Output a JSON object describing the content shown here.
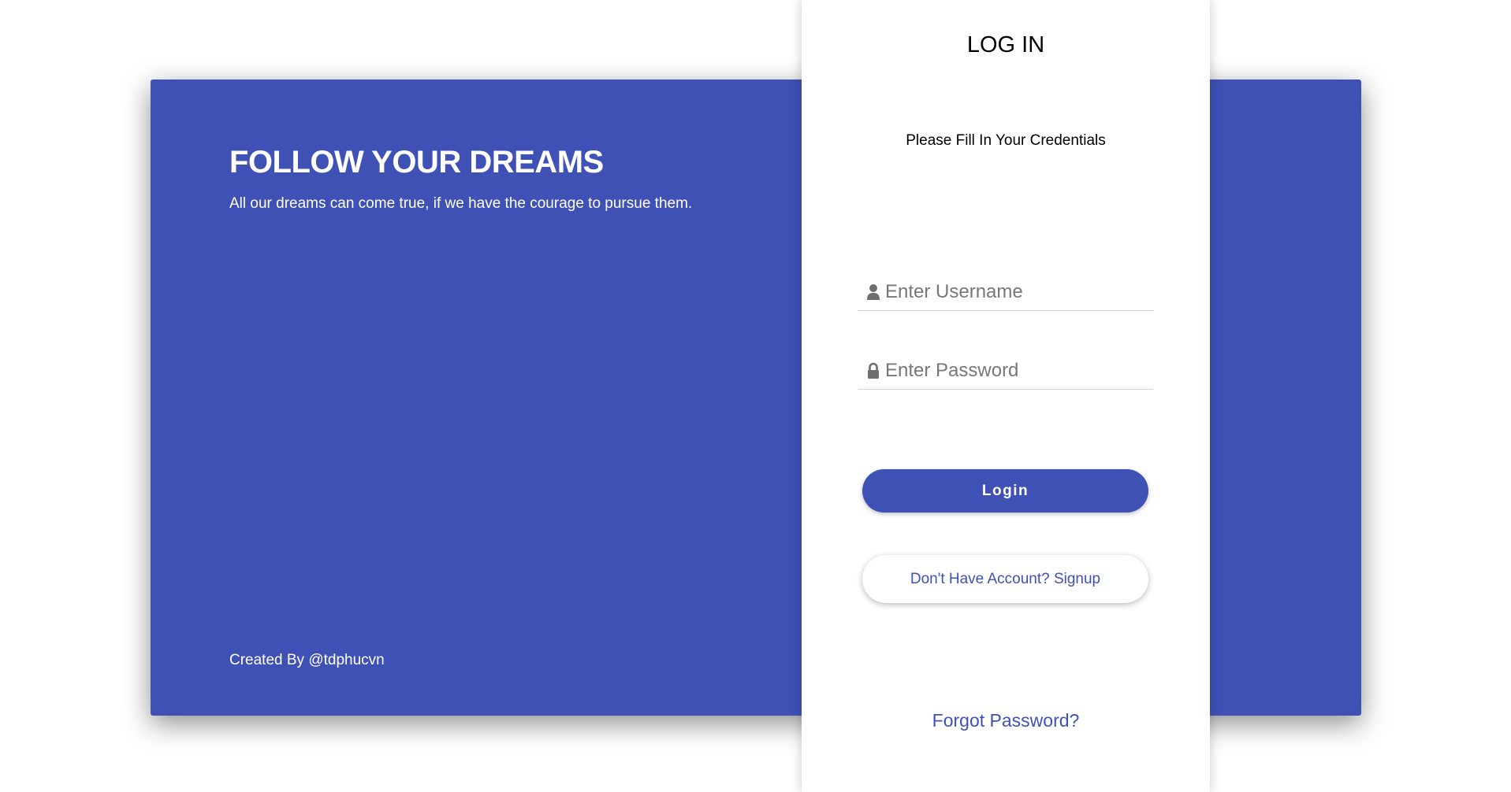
{
  "colors": {
    "accent": "#3f51b5",
    "background": "#ffffff",
    "placeholder": "#777777"
  },
  "hero": {
    "title": "FOLLOW YOUR DREAMS",
    "subtitle": "All our dreams can come true, if we have the courage to pursue them.",
    "credit": "Created By @tdphucvn"
  },
  "login": {
    "title": "LOG IN",
    "subtitle": "Please Fill In Your Credentials",
    "username": {
      "icon": "user-icon",
      "placeholder": "Enter Username",
      "value": ""
    },
    "password": {
      "icon": "lock-icon",
      "placeholder": "Enter Password",
      "value": ""
    },
    "login_button": "Login",
    "signup_button": "Don't Have Account? Signup",
    "forgot_link": "Forgot Password?"
  }
}
